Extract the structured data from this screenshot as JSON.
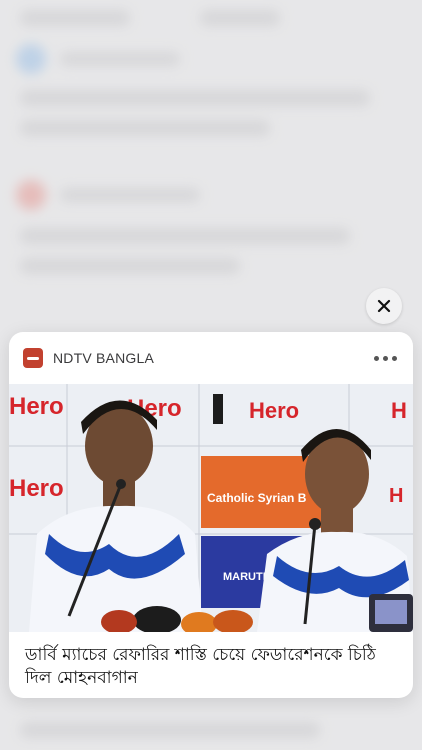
{
  "card": {
    "publisher": "NDTV BANGLA",
    "headline": "ডার্বি ম্যাচের রেফারির শাস্তি চেয়ে ফেডারেশনকে চিঠি দিল মোহনবাগান",
    "photo_backdrop_words": {
      "hero": "Hero",
      "sponsor": "Catholic Syrian B",
      "maruti": "MARUTI"
    }
  },
  "colors": {
    "brand": "#c2412f",
    "hero_red": "#d6252b",
    "sponsor_orange": "#e46a2c",
    "maruti_blue": "#2b3aa0"
  },
  "icons": {
    "close": "close-icon",
    "more": "more-icon"
  }
}
